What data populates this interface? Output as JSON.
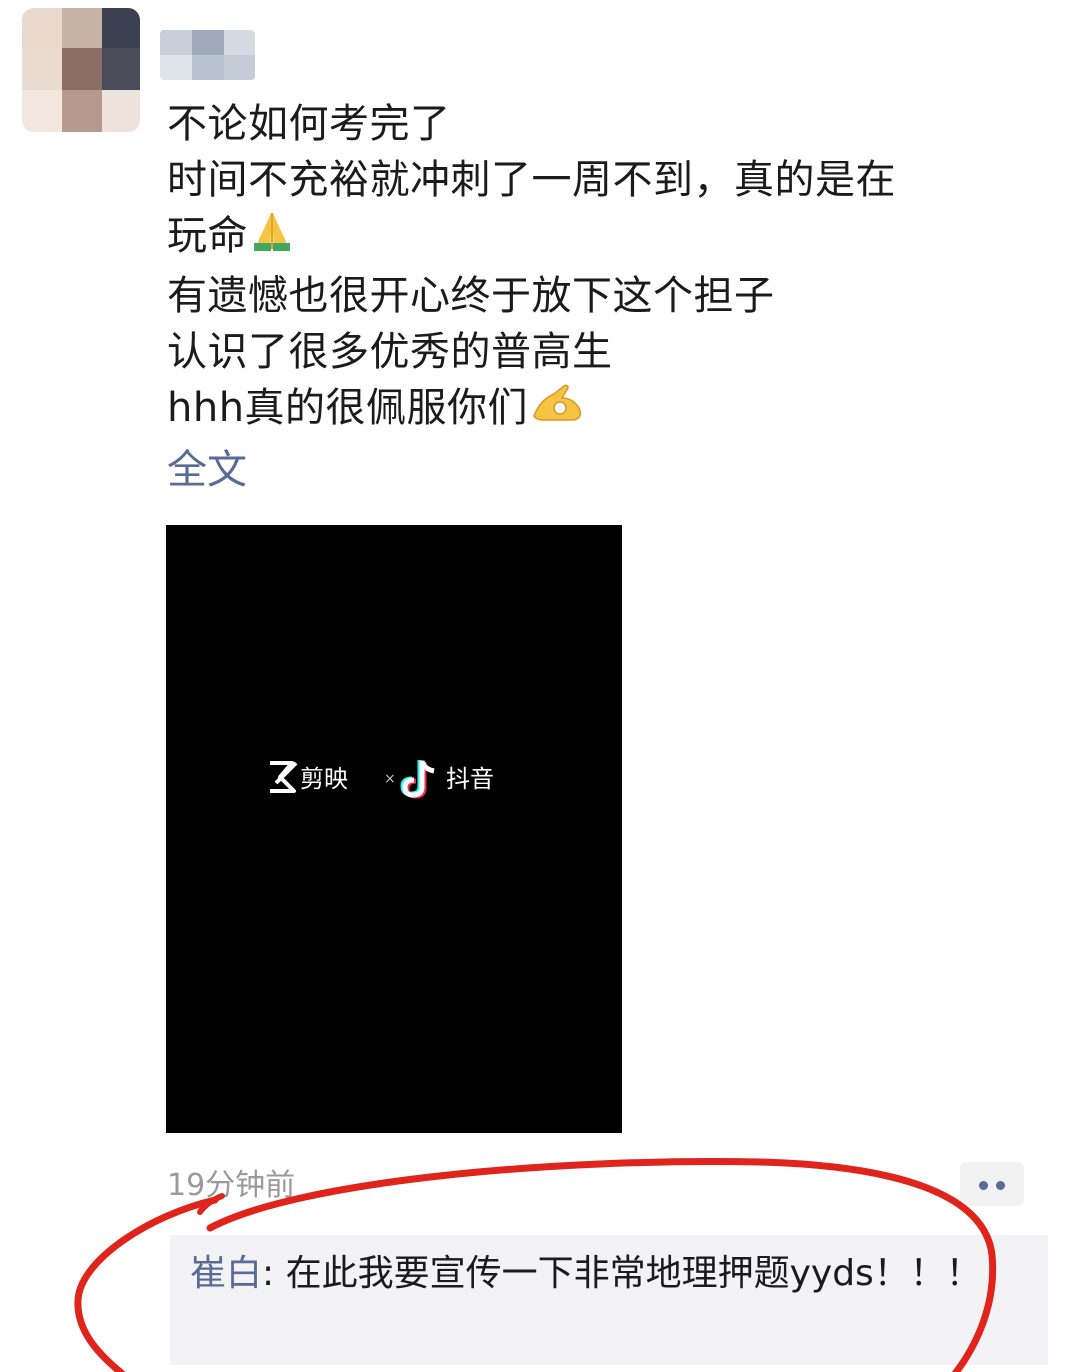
{
  "post": {
    "lines": [
      "不论如何考完了",
      "时间不充裕就冲刺了一周不到，真的是在",
      "玩命",
      "有遗憾也很开心终于放下这个担子",
      "认识了很多优秀的普高生",
      "hhh真的很佩服你们"
    ],
    "line3_emoji": "praying-hands-emoji",
    "line6_emoji": "ok-hand-emoji",
    "full_text_link": "全文"
  },
  "video": {
    "logo_left": "剪映",
    "logo_separator": "×",
    "logo_right": "抖音",
    "logo_icon_left": "jianying-logo-icon",
    "logo_icon_right": "tiktok-logo-icon"
  },
  "meta": {
    "timestamp": "19分钟前"
  },
  "comments": [
    {
      "author": "崔白",
      "separator": ": ",
      "text": "在此我要宣传一下非常地理押题yyds！！！"
    }
  ],
  "colors": {
    "link": "#576b95",
    "text": "#1b1b1b",
    "meta": "#9a9a9a",
    "comment_bg": "#f3f3f5",
    "annotation": "#e0241b"
  }
}
